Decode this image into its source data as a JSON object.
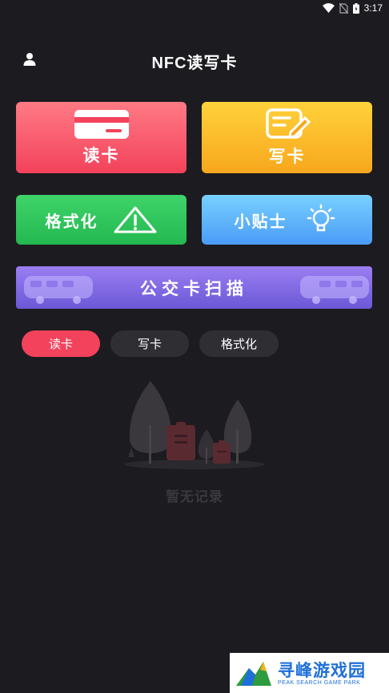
{
  "status_bar": {
    "time": "3:17",
    "icons": [
      "wifi-icon",
      "no-sim-icon",
      "battery-icon"
    ]
  },
  "header": {
    "title": "NFC读写卡",
    "user_icon": "user-icon"
  },
  "tiles": {
    "read": {
      "label": "读卡",
      "icon": "card-icon",
      "color": "#f3425b"
    },
    "write": {
      "label": "写卡",
      "icon": "edit-icon",
      "color": "#f7a71d"
    },
    "format": {
      "label": "格式化",
      "icon": "warning-icon",
      "color": "#24b850"
    },
    "tips": {
      "label": "小贴士",
      "icon": "lightbulb-icon",
      "color": "#4a9cf6"
    },
    "bus": {
      "label": "公交卡扫描",
      "icon": "bus-icon",
      "color": "#6b58d6"
    }
  },
  "filter_tabs": [
    {
      "label": "读卡",
      "active": true
    },
    {
      "label": "写卡",
      "active": false
    },
    {
      "label": "格式化",
      "active": false
    }
  ],
  "empty_state": {
    "text": "暂无记录",
    "icon": "empty-forest-illustration"
  },
  "watermark": {
    "title": "寻峰游戏园",
    "subtitle": "PEAK SEARCH GAME PARK"
  }
}
